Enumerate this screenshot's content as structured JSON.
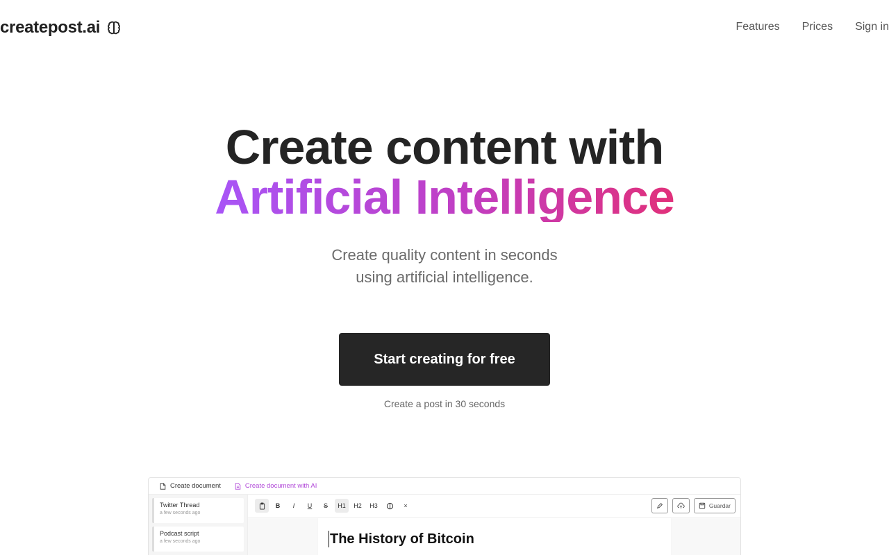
{
  "nav": {
    "logo_text": "createpost.ai",
    "logo_icon": "brain-icon",
    "links": [
      "Features",
      "Prices",
      "Sign in"
    ]
  },
  "hero": {
    "title_line1": "Create content with",
    "title_line2": "Artificial Intelligence",
    "subtitle_line1": "Create quality content in seconds",
    "subtitle_line2": "using artificial intelligence.",
    "cta_label": "Start creating for free",
    "cta_note": "Create a post in 30 seconds"
  },
  "colors": {
    "accent_gradient_start": "#a855f7",
    "accent_gradient_end": "#e1307a",
    "cta_background": "#262626"
  },
  "preview": {
    "tabs": [
      {
        "label": "Create document",
        "icon": "file-icon"
      },
      {
        "label": "Create document with AI",
        "icon": "file-ai-icon"
      }
    ],
    "sidebar_items": [
      {
        "title": "Twitter Thread",
        "time": "a few seconds ago"
      },
      {
        "title": "Podcast script",
        "time": "a few seconds ago"
      }
    ],
    "toolbar": {
      "bold": "B",
      "italic": "I",
      "underline": "U",
      "strike": "S",
      "h1": "H1",
      "h2": "H2",
      "h3": "H3",
      "clear": "×",
      "save_label": "Guardar"
    },
    "document_title": "The History of Bitcoin"
  }
}
